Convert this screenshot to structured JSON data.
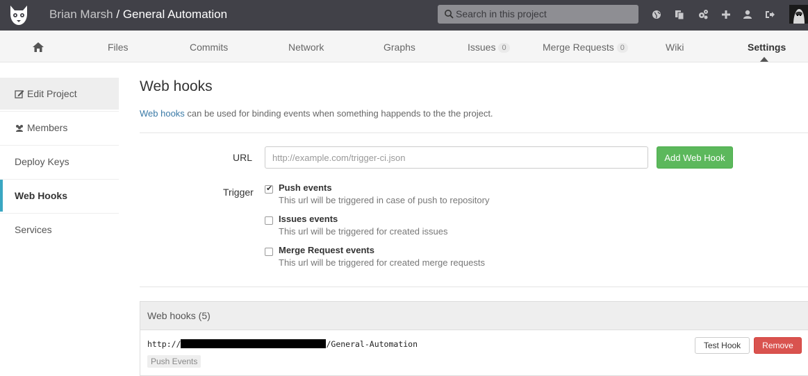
{
  "header": {
    "owner": "Brian Marsh",
    "separator": " / ",
    "project": "General Automation",
    "search_placeholder": "Search in this project",
    "icons": [
      "globe-icon",
      "copy-icon",
      "cogs-icon",
      "plus-icon",
      "user-icon",
      "sign-out-icon"
    ]
  },
  "nav": {
    "home_icon": "home-icon",
    "items": [
      {
        "label": "Files"
      },
      {
        "label": "Commits"
      },
      {
        "label": "Network"
      },
      {
        "label": "Graphs"
      },
      {
        "label": "Issues",
        "count": "0"
      },
      {
        "label": "Merge Requests",
        "count": "0"
      },
      {
        "label": "Wiki"
      },
      {
        "label": "Settings"
      }
    ]
  },
  "sidebar": {
    "items": [
      {
        "label": "Edit Project",
        "icon": "edit-icon"
      },
      {
        "label": "Members",
        "icon": "users-icon"
      },
      {
        "label": "Deploy Keys"
      },
      {
        "label": "Web Hooks"
      },
      {
        "label": "Services"
      }
    ]
  },
  "main": {
    "title": "Web hooks",
    "desc_link": "Web hooks",
    "desc_rest": " can be used for binding events when something happends to the the project.",
    "url_label": "URL",
    "url_placeholder": "http://example.com/trigger-ci.json",
    "add_button": "Add Web Hook",
    "trigger_label": "Trigger",
    "events": [
      {
        "title": "Push events",
        "help": "This url will be triggered in case of push to repository",
        "checked": true
      },
      {
        "title": "Issues events",
        "help": "This url will be triggered for created issues",
        "checked": false
      },
      {
        "title": "Merge Request events",
        "help": "This url will be triggered for created merge requests",
        "checked": false
      }
    ]
  },
  "hooks": {
    "heading": "Web hooks (5)",
    "items": [
      {
        "url_prefix": "http://",
        "url_suffix": "/General-Automation",
        "badge": "Push Events",
        "test_label": "Test Hook",
        "remove_label": "Remove"
      }
    ]
  },
  "colors": {
    "header_bg": "#414148",
    "accent": "#3aa7c2",
    "success": "#5cb85c",
    "danger": "#d9534f",
    "link": "#3a7aa7"
  }
}
